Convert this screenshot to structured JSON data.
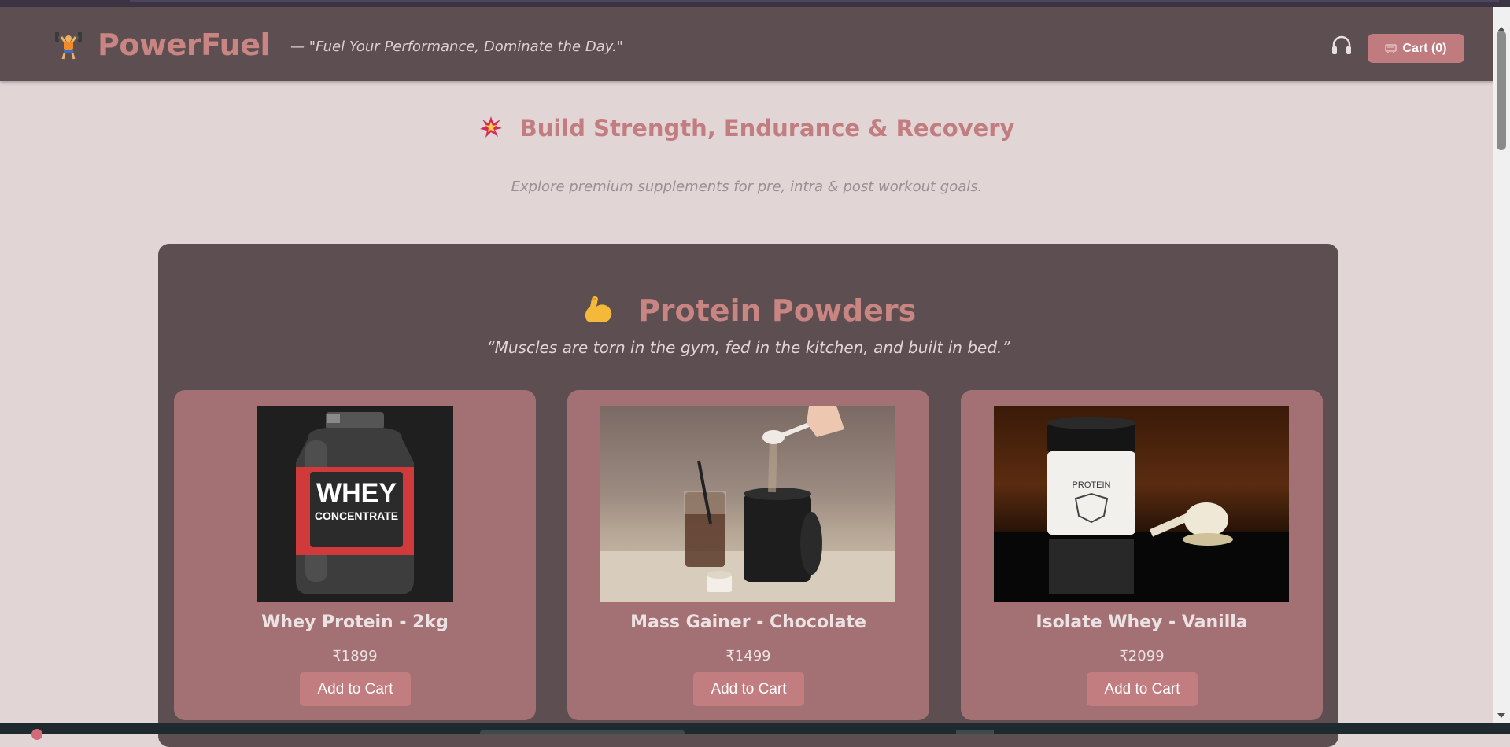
{
  "header": {
    "brand": "PowerFuel",
    "logo_icon": "weightlifter-icon",
    "tagline": "— \"Fuel Your Performance, Dominate the Day.\"",
    "support_icon": "headset-icon",
    "cart_label": "Cart (0)",
    "cart_icon": "cart-icon"
  },
  "hero": {
    "icon": "burst-icon",
    "title": "Build Strength, Endurance & Recovery",
    "subtitle": "Explore premium supplements for pre, intra & post workout goals."
  },
  "section": {
    "icon": "flexed-biceps-icon",
    "title": "Protein Powders",
    "quote": "“Muscles are torn in the gym, fed in the kitchen, and built in bed.”",
    "products": [
      {
        "name": "Whey Protein - 2kg",
        "price": "₹1899",
        "button": "Add to Cart",
        "image_text_1": "WHEY",
        "image_text_2": "CONCENTRATE"
      },
      {
        "name": "Mass Gainer - Chocolate",
        "price": "₹1499",
        "button": "Add to Cart"
      },
      {
        "name": "Isolate Whey - Vanilla",
        "price": "₹2099",
        "button": "Add to Cart",
        "image_text_1": "PROTEIN"
      }
    ]
  },
  "colors": {
    "page_bg": "#e2d5d6",
    "header_bg": "#5d4e51",
    "accent": "#c98582",
    "card_bg": "#a37173",
    "button_bg": "#c27d80"
  }
}
